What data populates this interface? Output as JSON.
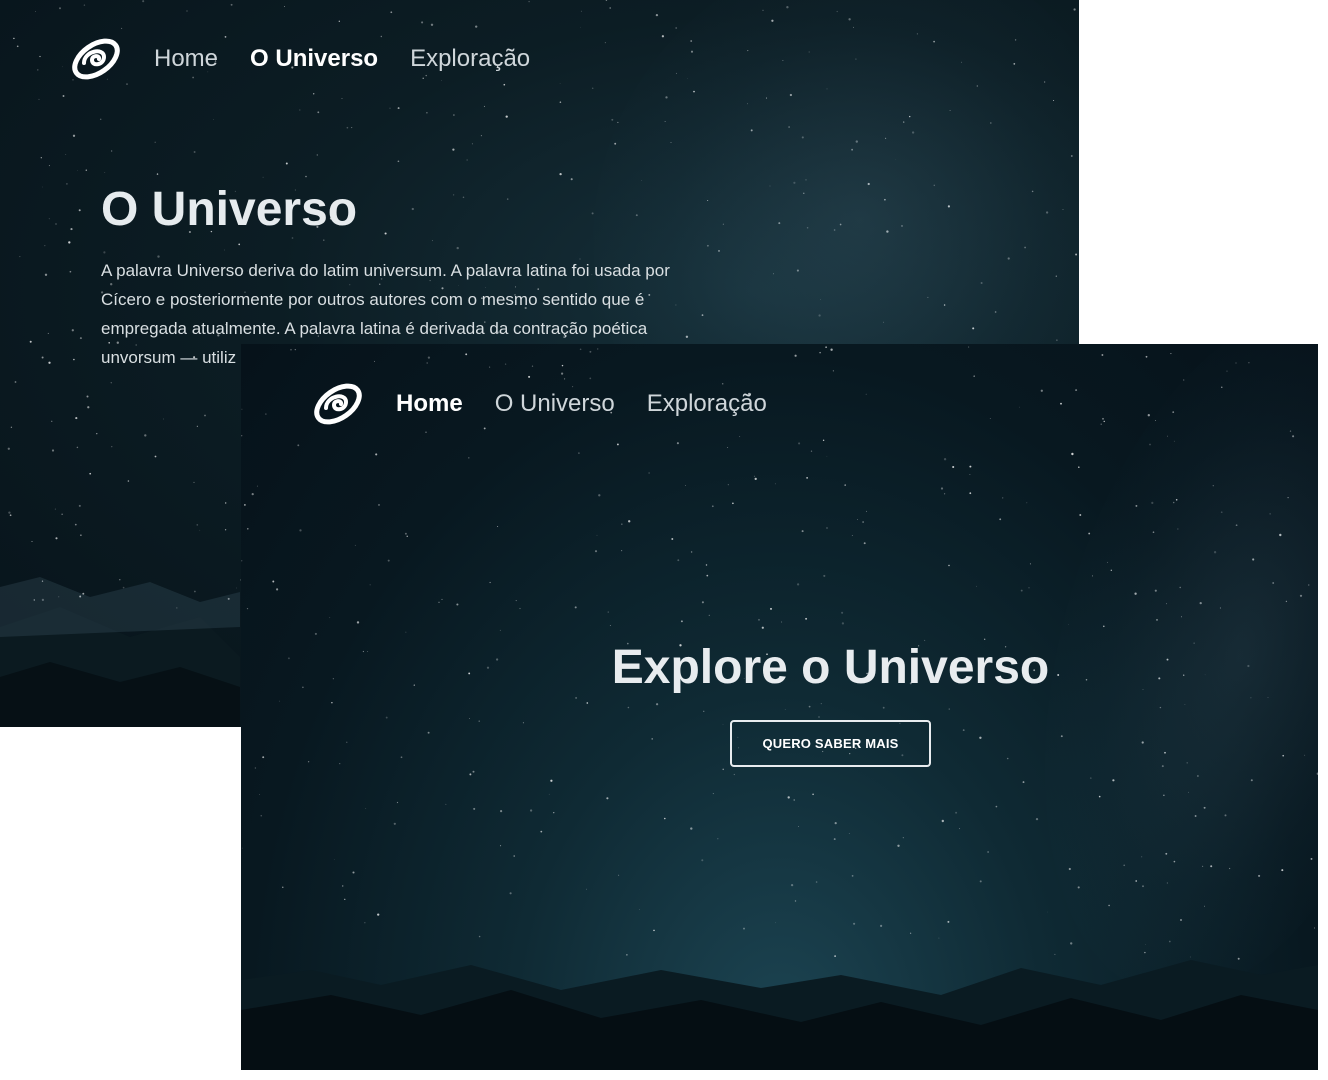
{
  "back_page": {
    "nav": {
      "logo": "spiral-logo-icon",
      "items": [
        {
          "label": "Home",
          "active": false
        },
        {
          "label": "O Universo",
          "active": true
        },
        {
          "label": "Exploração",
          "active": false
        }
      ]
    },
    "title": "O Universo",
    "paragraph": "A palavra Universo deriva do latim universum. A palavra latina foi usada por Cícero e posteriormente por outros autores com o mesmo sentido que é empregada atualmente. A palavra latina é derivada da contração poética unvorsum — utiliz Natureza das cois significa \"algo roc"
  },
  "front_page": {
    "nav": {
      "logo": "spiral-logo-icon",
      "items": [
        {
          "label": "Home",
          "active": true
        },
        {
          "label": "O Universo",
          "active": false
        },
        {
          "label": "Exploração",
          "active": false
        }
      ]
    },
    "hero": {
      "title": "Explore o Universo",
      "button_label": "QUERO SABER MAIS"
    }
  },
  "colors": {
    "sky_dark": "#07131a",
    "sky_mid": "#0f2a34",
    "text_light": "#e8ecef",
    "button_border": "#e8ecef"
  }
}
